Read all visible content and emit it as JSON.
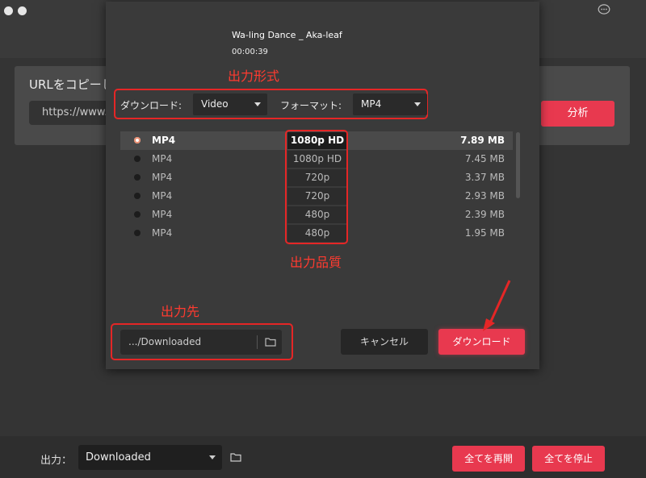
{
  "app": {
    "url_title": "URLをコピーし",
    "url_value": "https://www.ni",
    "analyze_label": "分析"
  },
  "bottom": {
    "output_label": "出力：",
    "output_value": "Downloaded",
    "resume_all_label": "全てを再開",
    "stop_all_label": "全てを停止"
  },
  "dialog": {
    "video_title": "Wa-ling Dance _ Aka-leaf",
    "duration": "00:00:39",
    "download_label": "ダウンロード:",
    "download_type": "Video",
    "format_label": "フォーマット:",
    "format_value": "MP4",
    "rows": [
      {
        "format": "MP4",
        "quality": "1080p HD",
        "size": "7.89 MB",
        "selected": true
      },
      {
        "format": "MP4",
        "quality": "1080p HD",
        "size": "7.45 MB",
        "selected": false
      },
      {
        "format": "MP4",
        "quality": "720p",
        "size": "3.37 MB",
        "selected": false
      },
      {
        "format": "MP4",
        "quality": "720p",
        "size": "2.93 MB",
        "selected": false
      },
      {
        "format": "MP4",
        "quality": "480p",
        "size": "2.39 MB",
        "selected": false
      },
      {
        "format": "MP4",
        "quality": "480p",
        "size": "1.95 MB",
        "selected": false
      }
    ],
    "path": ".../Downloaded",
    "cancel_label": "キャンセル",
    "confirm_label": "ダウンロード"
  },
  "annotations": {
    "output_format": "出力形式",
    "output_quality": "出力品質",
    "output_destination": "出力先"
  },
  "colors": {
    "accent": "#e8394f",
    "annotation": "#e52626"
  }
}
